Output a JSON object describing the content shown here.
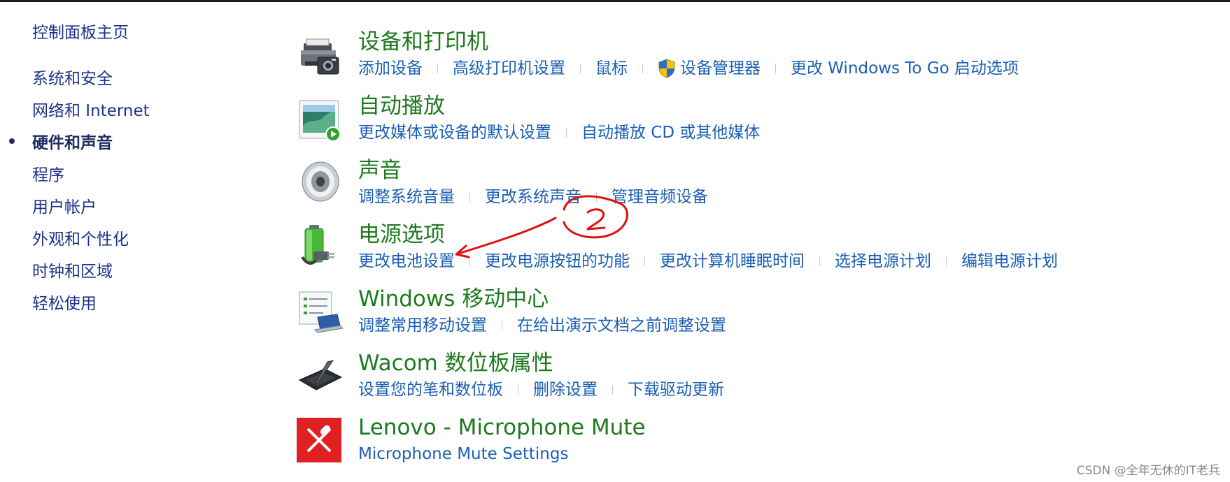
{
  "nav": {
    "home": "控制面板主页",
    "items": [
      {
        "label": "系统和安全"
      },
      {
        "label": "网络和 Internet"
      },
      {
        "label": "硬件和声音"
      },
      {
        "label": "程序"
      },
      {
        "label": "用户帐户"
      },
      {
        "label": "外观和个性化"
      },
      {
        "label": "时钟和区域"
      },
      {
        "label": "轻松使用"
      }
    ]
  },
  "categories": [
    {
      "title": "设备和打印机",
      "icon": "printer-camera-icon",
      "links": [
        "添加设备",
        "高级打印机设置",
        "鼠标",
        "设备管理器",
        "更改 Windows To Go 启动选项"
      ]
    },
    {
      "title": "自动播放",
      "icon": "autoplay-icon",
      "links": [
        "更改媒体或设备的默认设置",
        "自动播放 CD 或其他媒体"
      ]
    },
    {
      "title": "声音",
      "icon": "speaker-icon",
      "links": [
        "调整系统音量",
        "更改系统声音",
        "管理音频设备"
      ]
    },
    {
      "title": "电源选项",
      "icon": "battery-icon",
      "links": [
        "更改电池设置",
        "更改电源按钮的功能",
        "更改计算机睡眠时间",
        "选择电源计划",
        "编辑电源计划"
      ]
    },
    {
      "title": "Windows 移动中心",
      "icon": "mobility-center-icon",
      "links": [
        "调整常用移动设置",
        "在给出演示文档之前调整设置"
      ]
    },
    {
      "title": "Wacom 数位板属性",
      "icon": "tablet-icon",
      "links": [
        "设置您的笔和数位板",
        "删除设置",
        "下载驱动更新"
      ]
    },
    {
      "title": "Lenovo - Microphone Mute",
      "icon": "microphone-mute-icon",
      "links": [
        "Microphone Mute Settings"
      ]
    }
  ],
  "colors": {
    "title_green": "#1e7a1e",
    "link_blue": "#1a5fb4",
    "nav_blue": "#1e3287",
    "annotation_red": "#e01010"
  },
  "watermark": "CSDN @全年无休的IT老兵"
}
